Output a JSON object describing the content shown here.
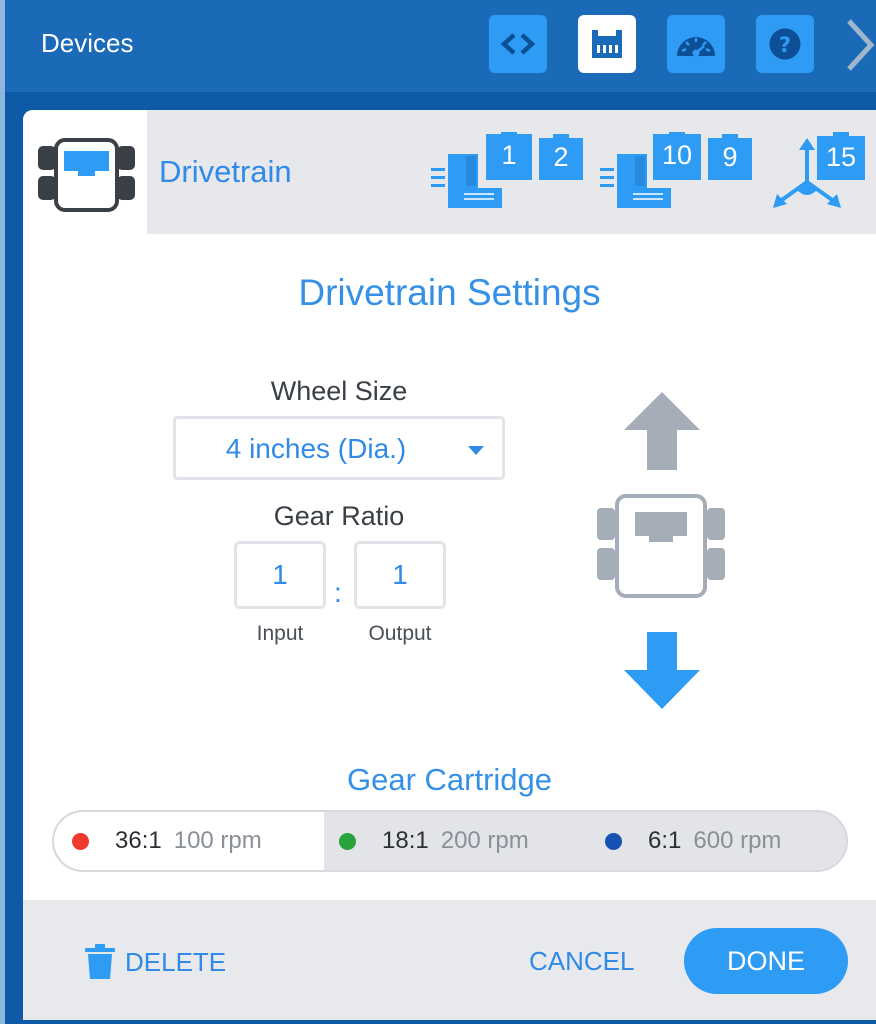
{
  "topbar": {
    "title": "Devices",
    "buttons": [
      {
        "icon": "code-icon",
        "active": false
      },
      {
        "icon": "ethernet-port-icon",
        "active": true
      },
      {
        "icon": "dashboard-gauge-icon",
        "active": false
      },
      {
        "icon": "help-icon",
        "active": false
      }
    ],
    "next_icon": "chevron-right-icon"
  },
  "device": {
    "name": "Drivetrain",
    "icon": "drivetrain-icon",
    "ports": [
      {
        "group": "left-motor",
        "numbers": [
          "1",
          "2"
        ]
      },
      {
        "group": "right-motor",
        "numbers": [
          "10",
          "9"
        ]
      },
      {
        "group": "gyro",
        "numbers": [
          "15"
        ]
      }
    ]
  },
  "settings": {
    "title": "Drivetrain Settings",
    "wheel_size_label": "Wheel Size",
    "wheel_size_value": "4 inches (Dia.)",
    "gear_ratio_label": "Gear Ratio",
    "ratio_input": "1",
    "ratio_output": "1",
    "ratio_separator": ":",
    "input_label": "Input",
    "output_label": "Output"
  },
  "cartridge": {
    "title": "Gear Cartridge",
    "options": [
      {
        "ratio": "36:1",
        "rpm": "100 rpm",
        "color": "#f03a2e",
        "selected": true
      },
      {
        "ratio": "18:1",
        "rpm": "200 rpm",
        "color": "#27a33a",
        "selected": false
      },
      {
        "ratio": "6:1",
        "rpm": "600 rpm",
        "color": "#1652b3",
        "selected": false
      }
    ]
  },
  "footer": {
    "delete_label": "DELETE",
    "cancel_label": "CANCEL",
    "done_label": "DONE"
  },
  "colors": {
    "accent": "#2e9bf5",
    "topbar": "#1a6ab8",
    "text_blue": "#2f8ae8"
  }
}
